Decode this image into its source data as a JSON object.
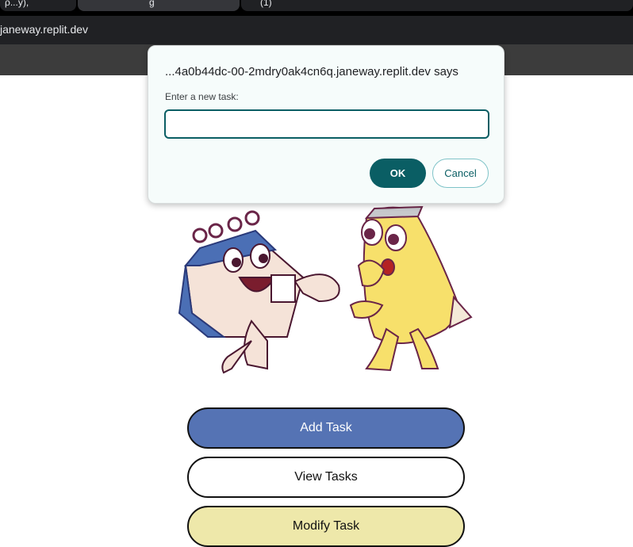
{
  "browser": {
    "tabs": [
      {
        "label": "ρ...y),"
      },
      {
        "label": "g"
      },
      {
        "label": "(1)"
      }
    ],
    "url": "janeway.replit.dev"
  },
  "dialog": {
    "title": "...4a0b44dc-00-2mdry0ak4cn6q.janeway.replit.dev says",
    "message": "Enter a new task:",
    "input_value": "",
    "ok_label": "OK",
    "cancel_label": "Cancel",
    "accent_color": "#0a5e64"
  },
  "main": {
    "illustration": "calendar-and-pencil-cartoon",
    "buttons": [
      {
        "label": "Add Task",
        "color": "#5573b4"
      },
      {
        "label": "View Tasks",
        "color": "#ffffff"
      },
      {
        "label": "Modify Task",
        "color": "#eee8aa"
      }
    ]
  }
}
